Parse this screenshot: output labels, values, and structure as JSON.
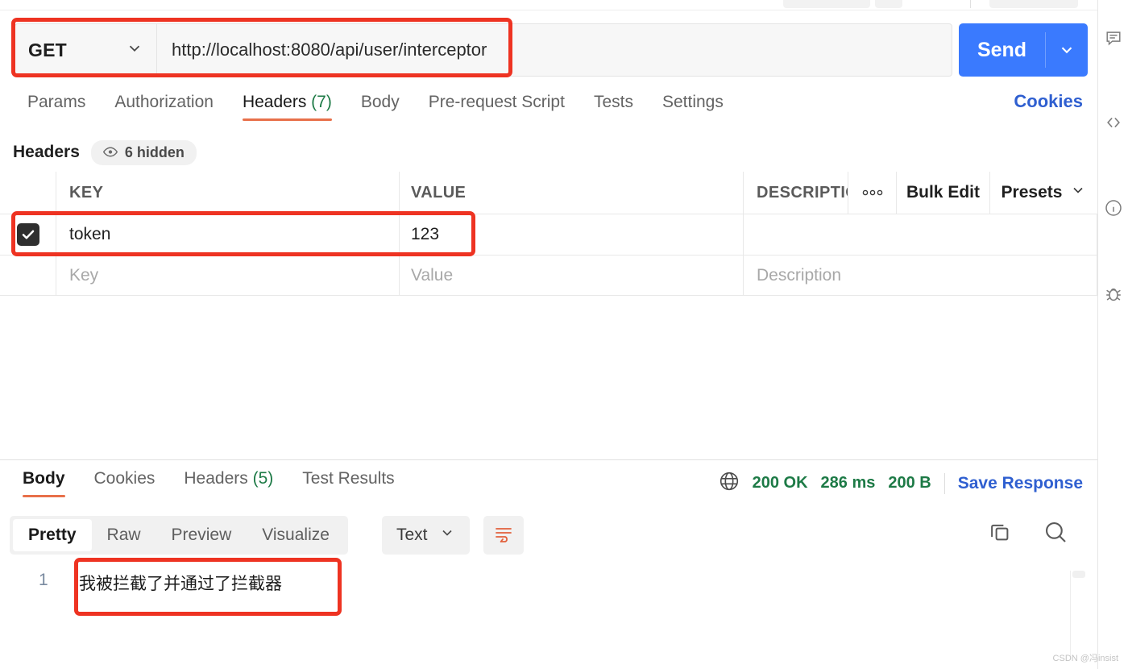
{
  "request": {
    "method": "GET",
    "url": "http://localhost:8080/api/user/interceptor",
    "send_label": "Send",
    "tabs": [
      {
        "label": "Params",
        "count": "",
        "active": false
      },
      {
        "label": "Authorization",
        "count": "",
        "active": false
      },
      {
        "label": "Headers",
        "count": "(7)",
        "active": true
      },
      {
        "label": "Body",
        "count": "",
        "active": false
      },
      {
        "label": "Pre-request Script",
        "count": "",
        "active": false
      },
      {
        "label": "Tests",
        "count": "",
        "active": false
      },
      {
        "label": "Settings",
        "count": "",
        "active": false
      }
    ],
    "cookies_link": "Cookies"
  },
  "headers_section": {
    "title": "Headers",
    "hidden_badge": "6 hidden",
    "columns": {
      "key": "KEY",
      "value": "VALUE",
      "description": "DESCRIPTIO"
    },
    "controls": {
      "more": "ooo",
      "bulk_edit": "Bulk Edit",
      "presets": "Presets"
    },
    "rows": [
      {
        "checked": true,
        "key": "token",
        "value": "123",
        "description": ""
      }
    ],
    "placeholders": {
      "key": "Key",
      "value": "Value",
      "description": "Description"
    }
  },
  "response": {
    "tabs": [
      {
        "label": "Body",
        "count": "",
        "active": true
      },
      {
        "label": "Cookies",
        "count": "",
        "active": false
      },
      {
        "label": "Headers",
        "count": "(5)",
        "active": false
      },
      {
        "label": "Test Results",
        "count": "",
        "active": false
      }
    ],
    "status": "200 OK",
    "time": "286 ms",
    "size": "200 B",
    "save_label": "Save Response",
    "view_modes": [
      {
        "label": "Pretty",
        "active": true
      },
      {
        "label": "Raw",
        "active": false
      },
      {
        "label": "Preview",
        "active": false
      },
      {
        "label": "Visualize",
        "active": false
      }
    ],
    "format": "Text",
    "line_number": "1",
    "body_text": "我被拦截了并通过了拦截器"
  },
  "colors": {
    "send_blue": "#3a7afe",
    "accent_orange": "#e8704a",
    "status_green": "#1d7a46",
    "link_blue": "#2f5fd0",
    "annotation_red": "#ee3322"
  },
  "watermark": "CSDN @冯insist"
}
